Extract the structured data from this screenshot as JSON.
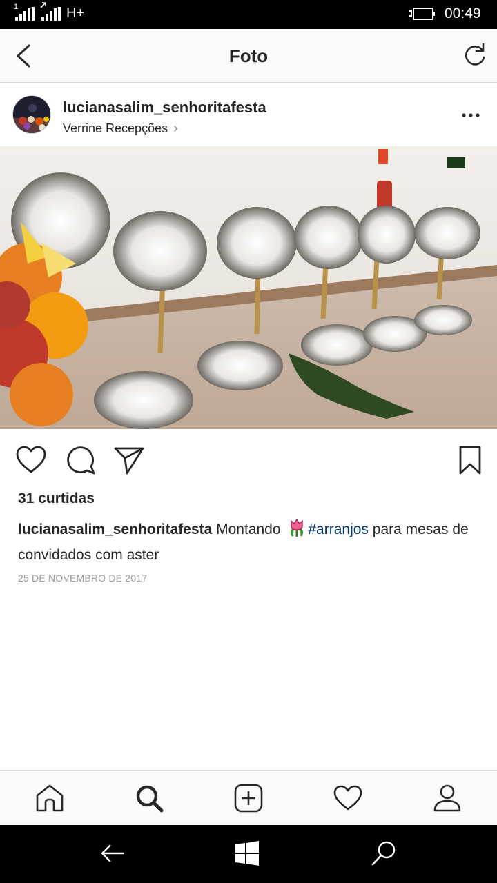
{
  "status_bar": {
    "sim1_label": "1",
    "network_type": "H+",
    "time": "00:49"
  },
  "header": {
    "title": "Foto",
    "back_icon": "chevron-left-icon",
    "refresh_icon": "refresh-icon"
  },
  "post": {
    "username": "lucianasalim_senhoritafesta",
    "location": "Verrine Recepções",
    "location_chevron": "›",
    "likes": "31 curtidas",
    "caption": {
      "user": "lucianasalim_senhoritafesta",
      "text_before": " Montando ",
      "emoji": "tulip-emoji",
      "hashtag": "#arranjos",
      "text_after": " para mesas de convidados com aster"
    },
    "date": "25 DE NOVEMBRO DE 2017",
    "action_icons": [
      "heart-icon",
      "comment-icon",
      "share-icon",
      "bookmark-icon"
    ]
  },
  "tab_bar": {
    "icons": [
      "home-icon",
      "search-icon",
      "add-icon",
      "activity-heart-icon",
      "profile-icon"
    ],
    "active": "search-icon"
  },
  "colors": {
    "hashtag": "#003569",
    "text": "#262626",
    "muted": "#999999",
    "header_bg": "#fafafa"
  }
}
